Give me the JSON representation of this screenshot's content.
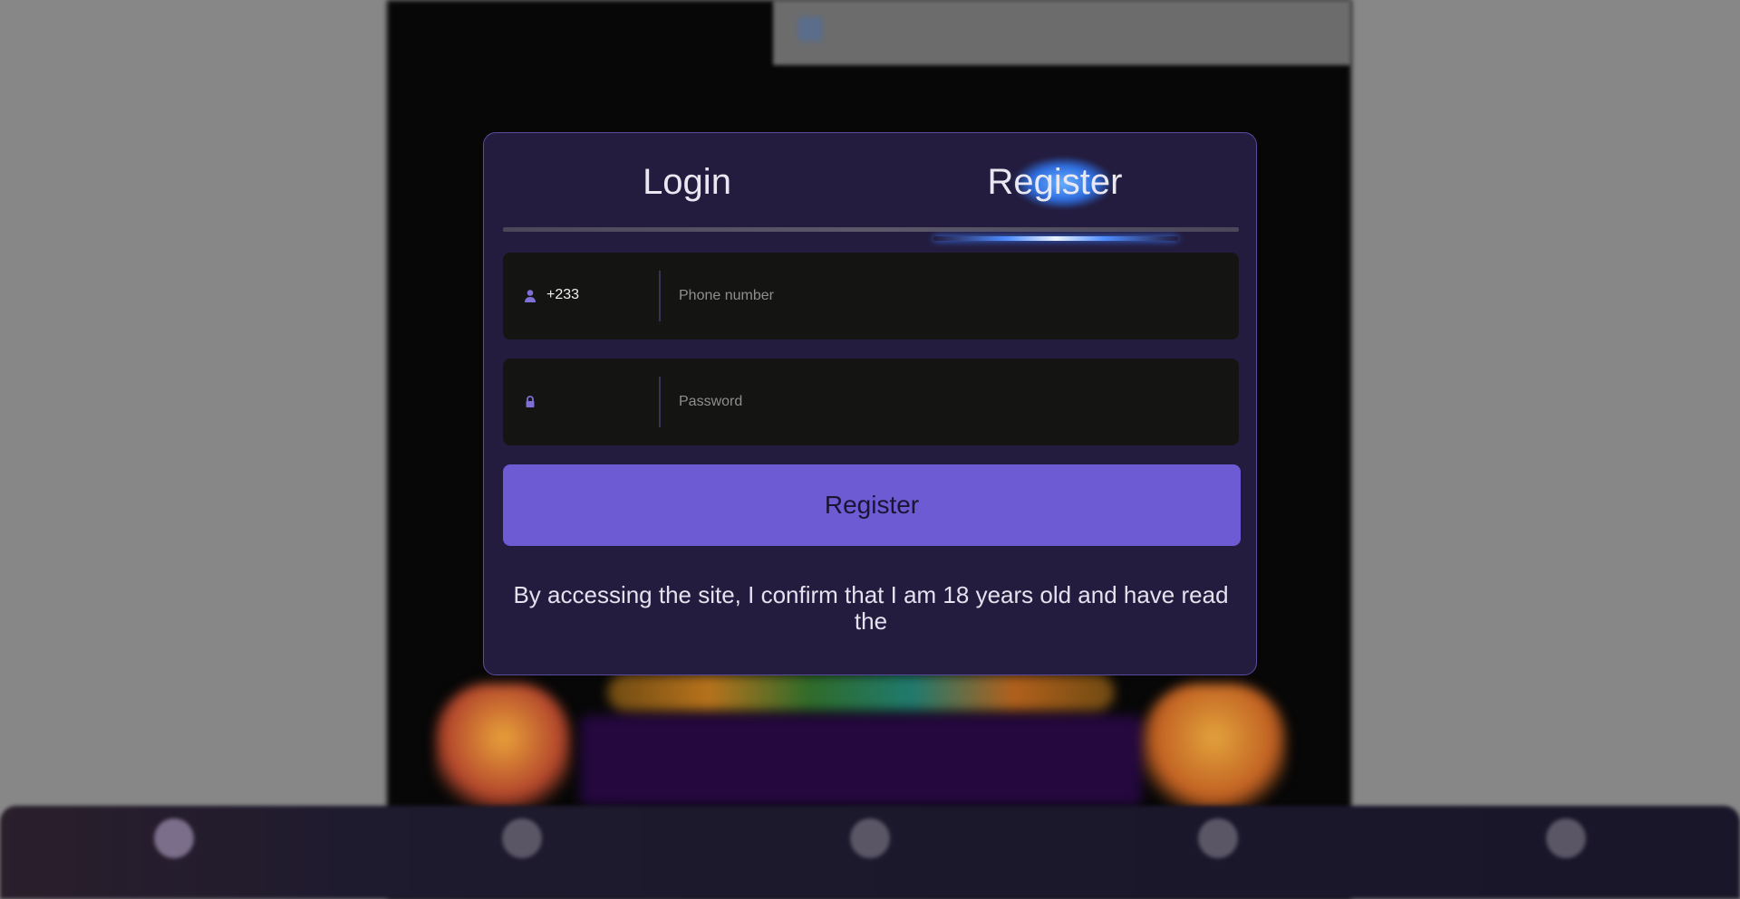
{
  "modal": {
    "tabs": [
      {
        "label": "Login",
        "active": false
      },
      {
        "label": "Register",
        "active": true
      }
    ],
    "phone": {
      "country_code": "+233",
      "placeholder": "Phone number",
      "icon": "user-icon"
    },
    "password": {
      "placeholder": "Password",
      "icon": "lock-icon"
    },
    "submit_label": "Register",
    "notice": "By accessing the site, I confirm that I am 18 years old and have read the"
  },
  "colors": {
    "modal_bg": "#231c3e",
    "accent": "#6c5bd3",
    "field_bg": "#141412",
    "tab_glow": "#4f8cff"
  },
  "bottom_nav": {
    "items": [
      {
        "icon": "home-icon",
        "active": true
      },
      {
        "icon": "promotions-icon",
        "active": false
      },
      {
        "icon": "deposit-icon",
        "active": false
      },
      {
        "icon": "rewards-icon",
        "active": false
      },
      {
        "icon": "account-icon",
        "active": false
      }
    ]
  }
}
